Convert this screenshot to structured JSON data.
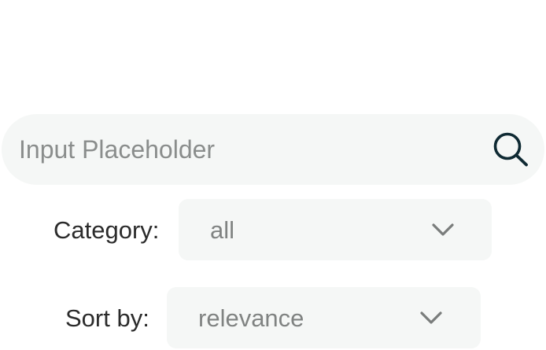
{
  "search": {
    "placeholder": "Input Placeholder",
    "value": "",
    "icon": "search-icon"
  },
  "filters": {
    "category": {
      "label": "Category:",
      "selected": "all",
      "icon": "chevron-down-icon"
    },
    "sort": {
      "label": "Sort by:",
      "selected": "relevance",
      "icon": "chevron-down-icon"
    }
  },
  "colors": {
    "field_background": "#f5f7f6",
    "icon_dark": "#0f2a33",
    "label_text": "#2b2b2b",
    "placeholder_text": "#8a8d8c",
    "select_text": "#808382",
    "chevron": "#7a7d7c"
  }
}
